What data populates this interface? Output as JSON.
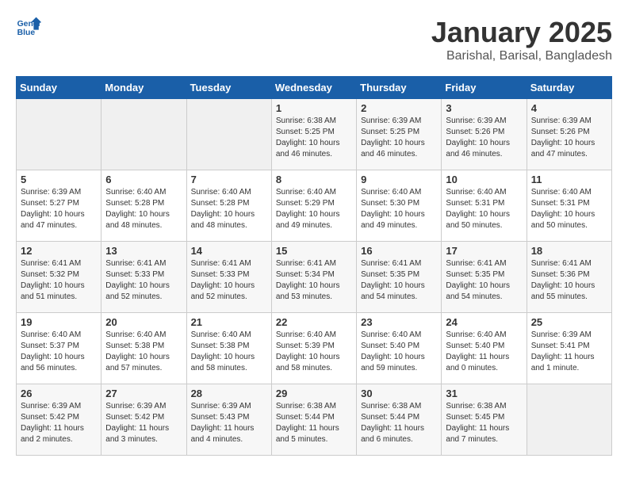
{
  "logo": {
    "line1": "General",
    "line2": "Blue"
  },
  "title": "January 2025",
  "subtitle": "Barishal, Barisal, Bangladesh",
  "days_of_week": [
    "Sunday",
    "Monday",
    "Tuesday",
    "Wednesday",
    "Thursday",
    "Friday",
    "Saturday"
  ],
  "weeks": [
    [
      {
        "day": "",
        "info": ""
      },
      {
        "day": "",
        "info": ""
      },
      {
        "day": "",
        "info": ""
      },
      {
        "day": "1",
        "info": "Sunrise: 6:38 AM\nSunset: 5:25 PM\nDaylight: 10 hours\nand 46 minutes."
      },
      {
        "day": "2",
        "info": "Sunrise: 6:39 AM\nSunset: 5:25 PM\nDaylight: 10 hours\nand 46 minutes."
      },
      {
        "day": "3",
        "info": "Sunrise: 6:39 AM\nSunset: 5:26 PM\nDaylight: 10 hours\nand 46 minutes."
      },
      {
        "day": "4",
        "info": "Sunrise: 6:39 AM\nSunset: 5:26 PM\nDaylight: 10 hours\nand 47 minutes."
      }
    ],
    [
      {
        "day": "5",
        "info": "Sunrise: 6:39 AM\nSunset: 5:27 PM\nDaylight: 10 hours\nand 47 minutes."
      },
      {
        "day": "6",
        "info": "Sunrise: 6:40 AM\nSunset: 5:28 PM\nDaylight: 10 hours\nand 48 minutes."
      },
      {
        "day": "7",
        "info": "Sunrise: 6:40 AM\nSunset: 5:28 PM\nDaylight: 10 hours\nand 48 minutes."
      },
      {
        "day": "8",
        "info": "Sunrise: 6:40 AM\nSunset: 5:29 PM\nDaylight: 10 hours\nand 49 minutes."
      },
      {
        "day": "9",
        "info": "Sunrise: 6:40 AM\nSunset: 5:30 PM\nDaylight: 10 hours\nand 49 minutes."
      },
      {
        "day": "10",
        "info": "Sunrise: 6:40 AM\nSunset: 5:31 PM\nDaylight: 10 hours\nand 50 minutes."
      },
      {
        "day": "11",
        "info": "Sunrise: 6:40 AM\nSunset: 5:31 PM\nDaylight: 10 hours\nand 50 minutes."
      }
    ],
    [
      {
        "day": "12",
        "info": "Sunrise: 6:41 AM\nSunset: 5:32 PM\nDaylight: 10 hours\nand 51 minutes."
      },
      {
        "day": "13",
        "info": "Sunrise: 6:41 AM\nSunset: 5:33 PM\nDaylight: 10 hours\nand 52 minutes."
      },
      {
        "day": "14",
        "info": "Sunrise: 6:41 AM\nSunset: 5:33 PM\nDaylight: 10 hours\nand 52 minutes."
      },
      {
        "day": "15",
        "info": "Sunrise: 6:41 AM\nSunset: 5:34 PM\nDaylight: 10 hours\nand 53 minutes."
      },
      {
        "day": "16",
        "info": "Sunrise: 6:41 AM\nSunset: 5:35 PM\nDaylight: 10 hours\nand 54 minutes."
      },
      {
        "day": "17",
        "info": "Sunrise: 6:41 AM\nSunset: 5:35 PM\nDaylight: 10 hours\nand 54 minutes."
      },
      {
        "day": "18",
        "info": "Sunrise: 6:41 AM\nSunset: 5:36 PM\nDaylight: 10 hours\nand 55 minutes."
      }
    ],
    [
      {
        "day": "19",
        "info": "Sunrise: 6:40 AM\nSunset: 5:37 PM\nDaylight: 10 hours\nand 56 minutes."
      },
      {
        "day": "20",
        "info": "Sunrise: 6:40 AM\nSunset: 5:38 PM\nDaylight: 10 hours\nand 57 minutes."
      },
      {
        "day": "21",
        "info": "Sunrise: 6:40 AM\nSunset: 5:38 PM\nDaylight: 10 hours\nand 58 minutes."
      },
      {
        "day": "22",
        "info": "Sunrise: 6:40 AM\nSunset: 5:39 PM\nDaylight: 10 hours\nand 58 minutes."
      },
      {
        "day": "23",
        "info": "Sunrise: 6:40 AM\nSunset: 5:40 PM\nDaylight: 10 hours\nand 59 minutes."
      },
      {
        "day": "24",
        "info": "Sunrise: 6:40 AM\nSunset: 5:40 PM\nDaylight: 11 hours\nand 0 minutes."
      },
      {
        "day": "25",
        "info": "Sunrise: 6:39 AM\nSunset: 5:41 PM\nDaylight: 11 hours\nand 1 minute."
      }
    ],
    [
      {
        "day": "26",
        "info": "Sunrise: 6:39 AM\nSunset: 5:42 PM\nDaylight: 11 hours\nand 2 minutes."
      },
      {
        "day": "27",
        "info": "Sunrise: 6:39 AM\nSunset: 5:42 PM\nDaylight: 11 hours\nand 3 minutes."
      },
      {
        "day": "28",
        "info": "Sunrise: 6:39 AM\nSunset: 5:43 PM\nDaylight: 11 hours\nand 4 minutes."
      },
      {
        "day": "29",
        "info": "Sunrise: 6:38 AM\nSunset: 5:44 PM\nDaylight: 11 hours\nand 5 minutes."
      },
      {
        "day": "30",
        "info": "Sunrise: 6:38 AM\nSunset: 5:44 PM\nDaylight: 11 hours\nand 6 minutes."
      },
      {
        "day": "31",
        "info": "Sunrise: 6:38 AM\nSunset: 5:45 PM\nDaylight: 11 hours\nand 7 minutes."
      },
      {
        "day": "",
        "info": ""
      }
    ]
  ]
}
